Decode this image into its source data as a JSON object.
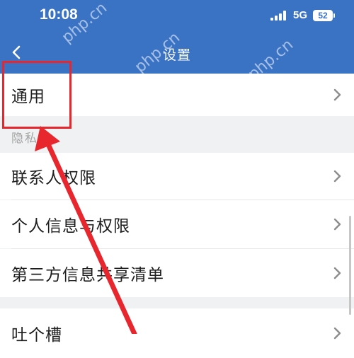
{
  "status_bar": {
    "time": "10:08",
    "network": "5G",
    "battery": "52"
  },
  "nav": {
    "title": "设置",
    "back_icon": "chevron-left-icon"
  },
  "rows": {
    "general": "通用",
    "contacts_permission": "联系人权限",
    "personal_info_permission": "个人信息与权限",
    "third_party_sharing": "第三方信息共享清单",
    "tucao": "吐个槽"
  },
  "sections": {
    "privacy": "隐私"
  },
  "watermark": "php.cn",
  "colors": {
    "header": "#3a72c4",
    "annotation": "#e8262d",
    "background": "#f0f1f3"
  }
}
